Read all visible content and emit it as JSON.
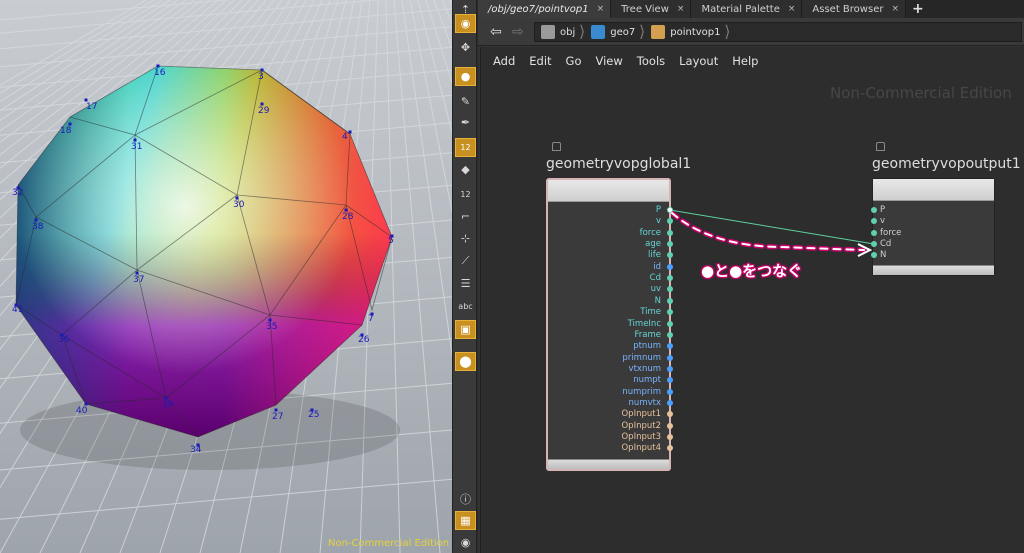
{
  "viewport": {
    "watermark": "Non-Commercial Edition",
    "points": [
      {
        "label": "16"
      },
      {
        "label": "3"
      },
      {
        "label": "17"
      },
      {
        "label": "29"
      },
      {
        "label": "18"
      },
      {
        "label": "31"
      },
      {
        "label": "4"
      },
      {
        "label": "32"
      },
      {
        "label": "30"
      },
      {
        "label": "28"
      },
      {
        "label": "38"
      },
      {
        "label": "5"
      },
      {
        "label": "37"
      },
      {
        "label": "41"
      },
      {
        "label": "7"
      },
      {
        "label": "35"
      },
      {
        "label": "36"
      },
      {
        "label": "26"
      },
      {
        "label": "39"
      },
      {
        "label": "40"
      },
      {
        "label": "27"
      },
      {
        "label": "25"
      },
      {
        "label": "34"
      }
    ]
  },
  "shelf": {
    "tools": [
      {
        "icon": "handle-icon"
      },
      {
        "icon": "view-icon"
      },
      {
        "icon": "pose-icon"
      },
      {
        "icon": "point-select-icon"
      },
      {
        "icon": "brush-icon"
      },
      {
        "icon": "pen-icon"
      },
      {
        "icon": "numbered-points-icon",
        "text": "12"
      },
      {
        "icon": "paint-icon"
      },
      {
        "icon": "vertex-numbers-icon",
        "text": "12"
      },
      {
        "icon": "angle-icon"
      },
      {
        "icon": "snap-icon"
      },
      {
        "icon": "measure-icon"
      },
      {
        "icon": "list-icon"
      },
      {
        "icon": "text-icon",
        "text": "abc"
      },
      {
        "icon": "image-icon"
      },
      {
        "icon": "pin-icon"
      },
      {
        "icon": "info-icon"
      },
      {
        "icon": "grid-icon"
      },
      {
        "icon": "eye-icon"
      }
    ]
  },
  "tabs": [
    {
      "label": "/obj/geo7/pointvop1",
      "close": "×",
      "active": true
    },
    {
      "label": "Tree View",
      "close": "×"
    },
    {
      "label": "Material Palette",
      "close": "×"
    },
    {
      "label": "Asset Browser",
      "close": "×"
    }
  ],
  "tab_plus": "+",
  "pathbar": {
    "back": "⇦",
    "forward": "⇨",
    "crumbs": [
      {
        "label": "obj",
        "icon": "obj-icon"
      },
      {
        "label": "geo7",
        "icon": "geo-icon"
      },
      {
        "label": "pointvop1",
        "icon": "vop-icon"
      }
    ]
  },
  "menubar": [
    "Add",
    "Edit",
    "Go",
    "View",
    "Tools",
    "Layout",
    "Help"
  ],
  "network_watermark": "Non-Commercial Edition",
  "nodes": {
    "global": {
      "name": "geometryvopglobal1",
      "outputs": [
        {
          "name": "P",
          "type": "vector"
        },
        {
          "name": "v",
          "type": "vector"
        },
        {
          "name": "force",
          "type": "vector"
        },
        {
          "name": "age",
          "type": "float"
        },
        {
          "name": "life",
          "type": "float"
        },
        {
          "name": "id",
          "type": "int"
        },
        {
          "name": "Cd",
          "type": "vector"
        },
        {
          "name": "uv",
          "type": "vector"
        },
        {
          "name": "N",
          "type": "vector"
        },
        {
          "name": "Time",
          "type": "float"
        },
        {
          "name": "TimeInc",
          "type": "float"
        },
        {
          "name": "Frame",
          "type": "float"
        },
        {
          "name": "ptnum",
          "type": "int"
        },
        {
          "name": "primnum",
          "type": "int"
        },
        {
          "name": "vtxnum",
          "type": "int"
        },
        {
          "name": "numpt",
          "type": "int"
        },
        {
          "name": "numprim",
          "type": "int"
        },
        {
          "name": "numvtx",
          "type": "int"
        },
        {
          "name": "OpInput1",
          "type": "string"
        },
        {
          "name": "OpInput2",
          "type": "string"
        },
        {
          "name": "OpInput3",
          "type": "string"
        },
        {
          "name": "OpInput4",
          "type": "string"
        }
      ]
    },
    "output": {
      "name": "geometryvopoutput1",
      "inputs": [
        {
          "name": "P"
        },
        {
          "name": "v"
        },
        {
          "name": "force"
        },
        {
          "name": "Cd"
        },
        {
          "name": "N"
        }
      ]
    }
  },
  "annotation": "●と●をつなぐ",
  "colors": {
    "vector": "#5fd0b0",
    "float": "#5fd0b0",
    "int": "#4aa0ff",
    "string": "#e6c19a",
    "annotation": "#c8006a"
  }
}
